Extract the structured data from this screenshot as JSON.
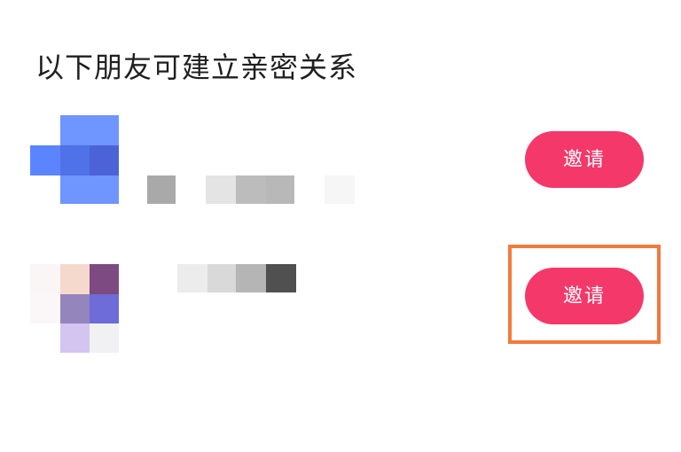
{
  "title": "以下朋友可建立亲密关系",
  "friends": [
    {
      "name": "",
      "avatar": "blurred-avatar-blue",
      "button_label": "邀请"
    },
    {
      "name": "",
      "avatar": "blurred-avatar-purple",
      "button_label": "邀请"
    }
  ],
  "colors": {
    "invite_button": "#f4386a",
    "highlight_box": "#f27a3c",
    "heading_text": "#1f1f1f"
  }
}
